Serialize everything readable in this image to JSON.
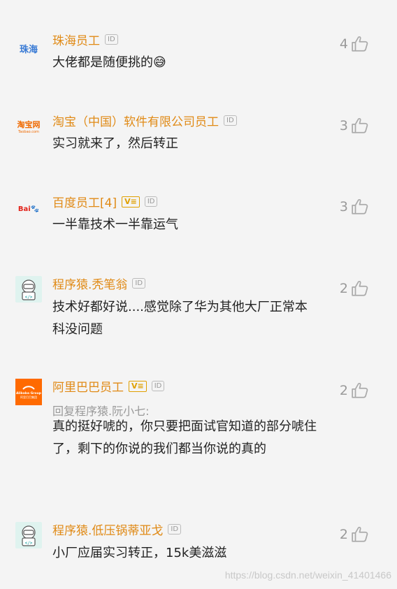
{
  "comments": [
    {
      "name": "珠海员工",
      "id_badge": "ID",
      "logo_text": "珠海",
      "logo_color": "#3a7bd5",
      "text": "大佬都是随便挑的😅",
      "likes": "4"
    },
    {
      "name": "淘宝（中国）软件有限公司员工",
      "id_badge": "ID",
      "logo_text": "淘宝网",
      "logo_sub": "Taobao.com",
      "logo_color": "#f06a00",
      "text": "实习就来了，然后转正",
      "likes": "3"
    },
    {
      "name": "百度员工[4]",
      "v_badge": "V≡",
      "id_badge": "ID",
      "logo_text": "Bai百度",
      "text": "一半靠技术一半靠运气",
      "likes": "3"
    },
    {
      "name": "程序猿.秃笔翁",
      "id_badge": "ID",
      "avatar_code": "</>",
      "text": "技术好都好说....感觉除了华为其他大厂正常本科没问题",
      "likes": "2"
    },
    {
      "name": "阿里巴巴员工",
      "v_badge": "V≡",
      "id_badge": "ID",
      "logo_text": "Alibaba Group",
      "logo_sub": "阿里巴巴集团",
      "logo_color": "#ff6a00",
      "reply_to": "回复程序猿.阮小七:",
      "text": "真的挺好唬的，你只要把面试官知道的部分唬住了，剩下的你说的我们都当你说的真的",
      "likes": "2"
    },
    {
      "name": "程序猿.低压锅蒂亚戈",
      "id_badge": "ID",
      "avatar_code": "</>",
      "text": "小厂应届实习转正，15k美滋滋",
      "likes": "2"
    }
  ],
  "watermark": "https://blog.csdn.net/weixin_41401466"
}
